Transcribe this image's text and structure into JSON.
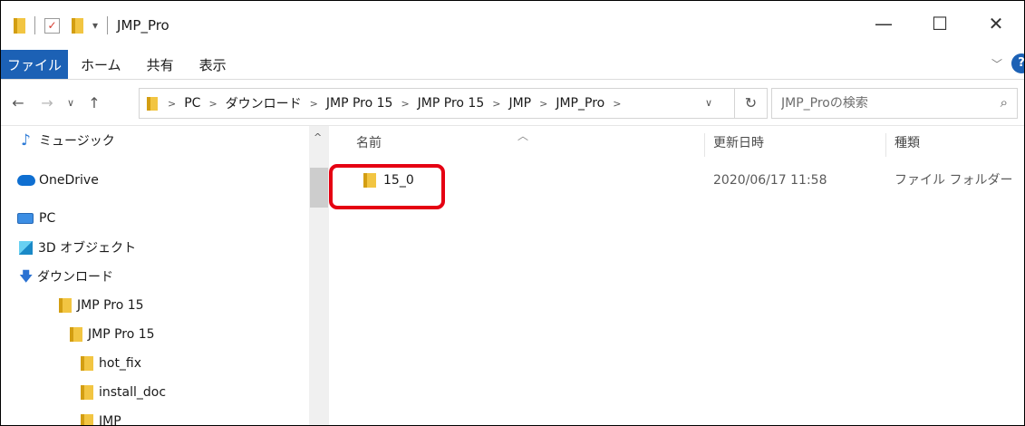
{
  "window": {
    "title": "JMP_Pro",
    "minimize_glyph": "—",
    "maximize_glyph": "☐",
    "close_glyph": "✕"
  },
  "ribbon": {
    "tabs": [
      "ファイル",
      "ホーム",
      "共有",
      "表示"
    ],
    "active_tab": "ファイル",
    "accent_color": "#1c61b5"
  },
  "address_bar": {
    "breadcrumbs": [
      "PC",
      "ダウンロード",
      "JMP Pro 15",
      "JMP Pro 15",
      "JMP",
      "JMP_Pro"
    ]
  },
  "search": {
    "placeholder": "JMP_Proの検索"
  },
  "nav_pane": {
    "items": [
      {
        "label": "ミュージック",
        "icon": "music-icon"
      },
      {
        "label": "OneDrive",
        "icon": "cloud-icon"
      },
      {
        "label": "PC",
        "icon": "pc-icon"
      },
      {
        "label": "3D オブジェクト",
        "icon": "cube-icon"
      },
      {
        "label": "ダウンロード",
        "icon": "download-icon"
      },
      {
        "label": "JMP Pro 15",
        "icon": "folder-icon"
      },
      {
        "label": "JMP Pro 15",
        "icon": "folder-icon"
      },
      {
        "label": "hot_fix",
        "icon": "folder-icon"
      },
      {
        "label": "install_doc",
        "icon": "folder-icon"
      },
      {
        "label": "JMP",
        "icon": "folder-icon"
      }
    ]
  },
  "file_list": {
    "columns": {
      "name": "名前",
      "modified": "更新日時",
      "type": "種類"
    },
    "rows": [
      {
        "name": "15_0",
        "modified": "2020/06/17 11:58",
        "type": "ファイル フォルダー"
      }
    ],
    "highlight_color": "#e50012"
  }
}
